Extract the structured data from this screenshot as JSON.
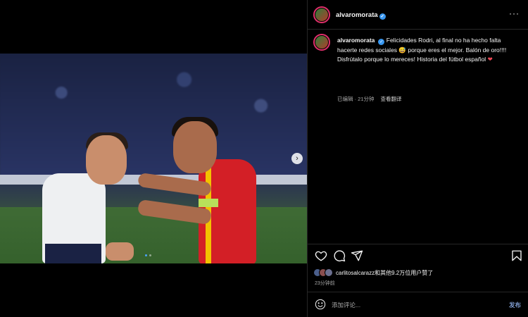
{
  "post": {
    "username": "alvaromorata",
    "verified": true,
    "caption": "Felicidades Rodri, al final no ha hecho falta hacerte redes sociales 😅 porque eres el mejor. Balón de oro!!!! Disfrútalo porque lo mereces! Historia del fútbol español",
    "caption_emoji": "❤",
    "meta_edited": "已编辑 · 21分钟",
    "meta_translate": "查看翻译"
  },
  "media": {
    "carousel_next_icon": "chevron-right-icon",
    "dots_total": 2,
    "dots_active": 1
  },
  "actions": {
    "icons": [
      "heart-icon",
      "comment-icon",
      "share-icon",
      "bookmark-icon"
    ]
  },
  "likes": {
    "user": "carlitosalcarazz",
    "text": "carlitosalcarazz和其他9.2万位用户赞了"
  },
  "timestamp": "23分钟前",
  "comment": {
    "placeholder": "添加评论...",
    "post_label": "发布"
  },
  "colors": {
    "background": "#000000",
    "verified": "#3897f0",
    "heart": "#ed4956",
    "post_button": "#7f9ccf"
  }
}
